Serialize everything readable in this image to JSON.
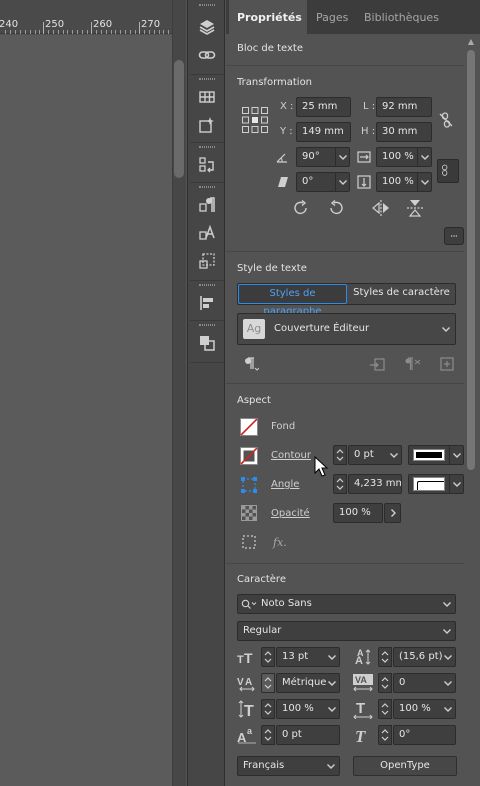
{
  "ruler": {
    "labels": [
      "240",
      "250",
      "260",
      "270"
    ]
  },
  "panel": {
    "tabs": [
      "Propriétés",
      "Pages",
      "Bibliothèques"
    ],
    "object_type": "Bloc de texte"
  },
  "transform": {
    "title": "Transformation",
    "x_label": "X :",
    "x_value": "25 mm",
    "y_label": "Y :",
    "y_value": "149 mm",
    "w_label": "L :",
    "w_value": "92 mm",
    "h_label": "H :",
    "h_value": "30 mm",
    "rotation": "90°",
    "shear": "0°",
    "scale_x": "100 %",
    "scale_y": "100 %"
  },
  "text_style": {
    "title": "Style de texte",
    "tab_paragraph": "Styles de paragraphe",
    "tab_character": "Styles de caractère",
    "style_icon_text": "Ag",
    "selected_style": "Couverture Éditeur"
  },
  "appearance": {
    "title": "Aspect",
    "fill_label": "Fond",
    "stroke_label": "Contour",
    "stroke_weight": "0 pt",
    "corner_label": "Angle",
    "corner_value": "4,233 mm",
    "opacity_label": "Opacité",
    "opacity_value": "100 %",
    "fx_label": "fx."
  },
  "character": {
    "title": "Caractère",
    "font_family": "Noto Sans",
    "font_style": "Regular",
    "font_size": "13 pt",
    "leading": "(15,6 pt)",
    "kerning": "Métrique",
    "tracking": "0",
    "vertical_scale": "100 %",
    "horizontal_scale": "100 %",
    "baseline_shift": "0 pt",
    "skew": "0°",
    "language": "Français",
    "opentype_label": "OpenType"
  },
  "colors": {
    "panel_bg": "#535353",
    "accent_blue": "#2d8ceb",
    "stroke_red": "#d22222"
  }
}
